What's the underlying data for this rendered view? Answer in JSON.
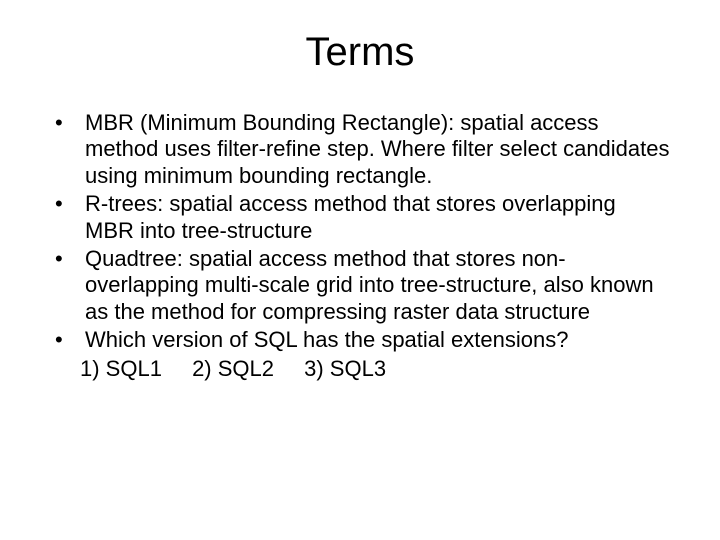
{
  "title": "Terms",
  "bullets": [
    "MBR (Minimum Bounding Rectangle): spatial access method uses filter-refine step. Where filter select candidates using minimum bounding rectangle.",
    "R-trees: spatial access method that stores overlapping MBR into tree-structure",
    "Quadtree: spatial access method that stores non-overlapping multi-scale grid into tree-structure, also known as the method for compressing raster data structure",
    "Which version of SQL has the spatial extensions?"
  ],
  "options": [
    "1) SQL1",
    "2) SQL2",
    "3) SQL3"
  ]
}
